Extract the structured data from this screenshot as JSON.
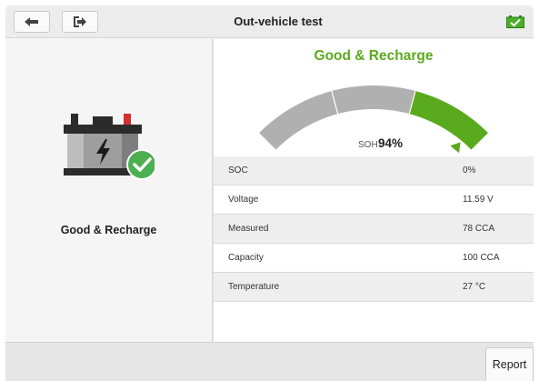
{
  "header": {
    "title": "Out-vehicle test",
    "back_icon": "back-arrow-icon",
    "exit_icon": "exit-icon",
    "battery_icon": "battery-ok-icon"
  },
  "left": {
    "battery_icon": "battery-check-icon",
    "status_label": "Good & Recharge"
  },
  "result": {
    "status": "Good & Recharge",
    "status_color": "#5aaa1e",
    "soh_label": "SOH",
    "soh_value": "94%",
    "soh_level": 0.94
  },
  "table": {
    "rows": [
      {
        "label": "SOC",
        "value": "0%"
      },
      {
        "label": "Voltage",
        "value": "11.59 V"
      },
      {
        "label": "Measured",
        "value": "78 CCA"
      },
      {
        "label": "Capacity",
        "value": "100 CCA"
      },
      {
        "label": "Temperature",
        "value": "27 °C"
      }
    ]
  },
  "footer": {
    "report_label": "Report"
  }
}
